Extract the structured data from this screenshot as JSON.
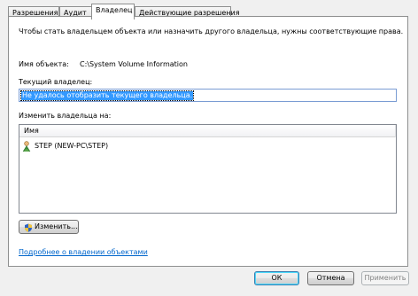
{
  "tabs": [
    "Разрешения",
    "Аудит",
    "Владелец",
    "Действующие разрешения"
  ],
  "active_tab": 2,
  "owner_panel": {
    "intro": "Чтобы стать владельцем объекта или назначить другого владельца, нужны соответствующие права.",
    "object_name_label": "Имя объекта:",
    "object_name_value": "C:\\System Volume Information",
    "current_owner_label": "Текущий владелец:",
    "current_owner_value": "Не удалось отобразить текущего владельца.",
    "change_owner_label": "Изменить владельца на:",
    "list_column": "Имя",
    "list_items": [
      "STEP (NEW-PC\\STEP)"
    ],
    "change_button": "Изменить...",
    "learn_more_link": "Подробнее о владении объектами"
  },
  "dialog_buttons": {
    "ok": "ОК",
    "cancel": "Отмена",
    "apply": "Применить"
  },
  "colors": {
    "selection": "#3399ff",
    "link": "#0066cc",
    "window_bg": "#f0f0f0"
  }
}
